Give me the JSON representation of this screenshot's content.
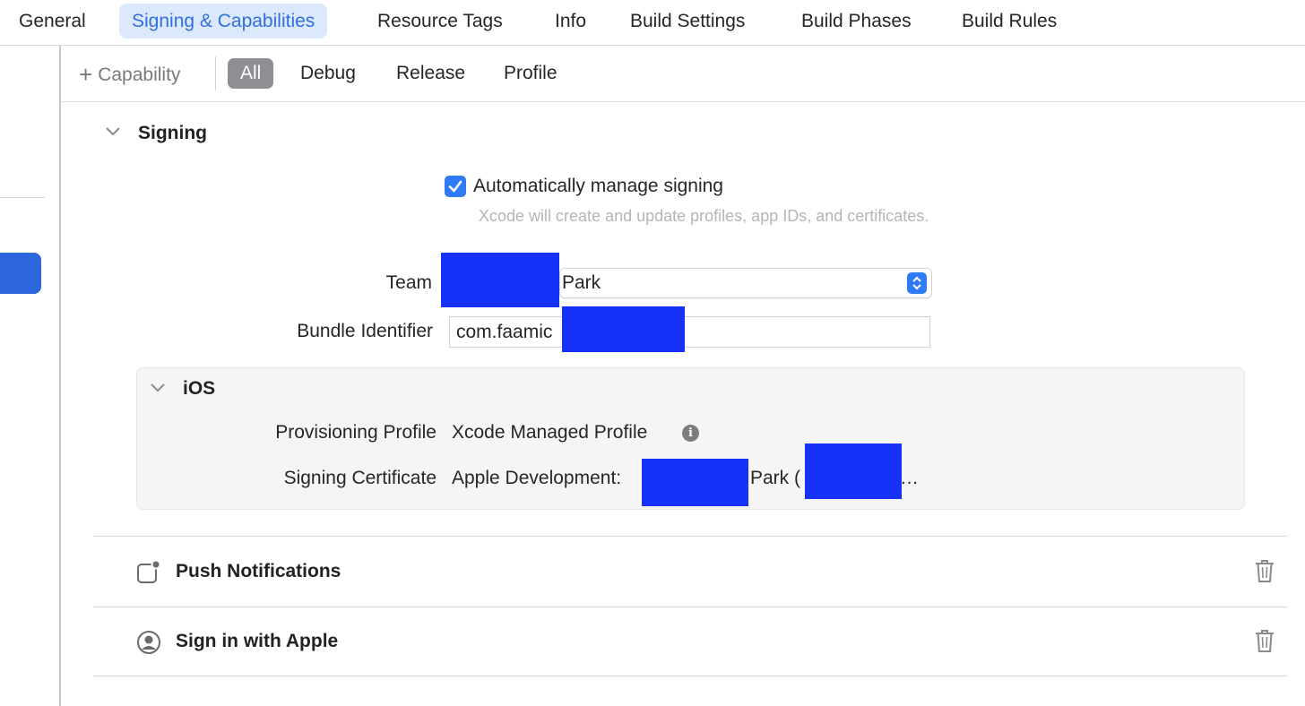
{
  "tabs": [
    {
      "label": "General",
      "active": false
    },
    {
      "label": "Signing & Capabilities",
      "active": true
    },
    {
      "label": "Resource Tags",
      "active": false
    },
    {
      "label": "Info",
      "active": false
    },
    {
      "label": "Build Settings",
      "active": false
    },
    {
      "label": "Build Phases",
      "active": false
    },
    {
      "label": "Build Rules",
      "active": false
    }
  ],
  "toolbar": {
    "add_capability": "Capability",
    "filters": [
      "All",
      "Debug",
      "Release",
      "Profile"
    ],
    "selected_filter": "All"
  },
  "signing": {
    "title": "Signing",
    "auto_manage_label": "Automatically manage signing",
    "auto_manage_checked": true,
    "auto_manage_help": "Xcode will create and update profiles, app IDs, and certificates.",
    "team_label": "Team",
    "team_value": "Park",
    "bundle_label": "Bundle Identifier",
    "bundle_value": "com.faamic"
  },
  "ios": {
    "title": "iOS",
    "profile_label": "Provisioning Profile",
    "profile_value": "Xcode Managed Profile",
    "cert_label": "Signing Certificate",
    "cert_value_prefix": "Apple Development:",
    "cert_value_mid": "Park (",
    "cert_value_suffix": "…"
  },
  "capabilities": [
    {
      "label": "Push Notifications",
      "icon": "push-notification-icon"
    },
    {
      "label": "Sign in with Apple",
      "icon": "person-circle-icon"
    }
  ],
  "colors": {
    "accent": "#2f7bf5",
    "selected_tab_bg": "#dce8fb",
    "selected_tab_text": "#2f6fe0",
    "redaction": "#1632f8"
  }
}
